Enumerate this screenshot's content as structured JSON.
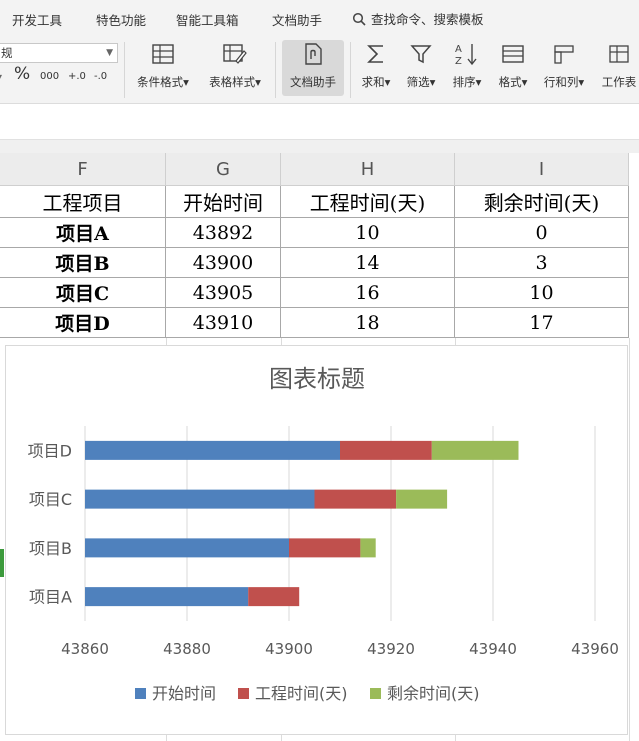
{
  "menu": {
    "tabs": [
      "开发工具",
      "特色功能",
      "智能工具箱",
      "文档助手"
    ],
    "search_placeholder": "查找命令、搜索模板"
  },
  "ribbon": {
    "number_format_value": "规",
    "format_buttons": [
      "%",
      "000",
      "+.0",
      "-.0"
    ],
    "buttons": [
      {
        "label": "条件格式",
        "icon": "conditional-format-icon",
        "dropdown": true
      },
      {
        "label": "表格样式",
        "icon": "table-style-icon",
        "dropdown": true
      },
      {
        "label": "文档助手",
        "icon": "document-assistant-icon",
        "dropdown": false,
        "active": true
      },
      {
        "label": "求和",
        "icon": "sum-icon",
        "dropdown": true
      },
      {
        "label": "筛选",
        "icon": "filter-icon",
        "dropdown": true
      },
      {
        "label": "排序",
        "icon": "sort-icon",
        "dropdown": true
      },
      {
        "label": "格式",
        "icon": "format-icon",
        "dropdown": true
      },
      {
        "label": "行和列",
        "icon": "rows-columns-icon",
        "dropdown": true
      },
      {
        "label": "工作表",
        "icon": "worksheet-icon",
        "dropdown": false
      }
    ]
  },
  "sheet": {
    "columns": [
      "F",
      "G",
      "H",
      "I"
    ],
    "header_row": [
      "工程项目",
      "开始时间",
      "工程时间(天)",
      "剩余时间(天)"
    ],
    "rows": [
      [
        "项目A",
        "43892",
        "10",
        "0"
      ],
      [
        "项目B",
        "43900",
        "14",
        "3"
      ],
      [
        "项目C",
        "43905",
        "16",
        "10"
      ],
      [
        "项目D",
        "43910",
        "18",
        "17"
      ]
    ]
  },
  "colors": {
    "series_start": "#4f81bd",
    "series_duration": "#c0504d",
    "series_remaining": "#9bbb59",
    "active_row_marker": "#3c9a3c"
  },
  "chart_data": {
    "type": "bar",
    "orientation": "horizontal",
    "stacked": true,
    "title": "图表标题",
    "categories": [
      "项目A",
      "项目B",
      "项目C",
      "项目D"
    ],
    "series": [
      {
        "name": "开始时间",
        "values": [
          43892,
          43900,
          43905,
          43910
        ]
      },
      {
        "name": "工程时间(天)",
        "values": [
          10,
          14,
          16,
          18
        ]
      },
      {
        "name": "剩余时间(天)",
        "values": [
          0,
          3,
          10,
          17
        ]
      }
    ],
    "xlim": [
      43860,
      43960
    ],
    "x_ticks": [
      "43860",
      "43880",
      "43900",
      "43920",
      "43940",
      "43960"
    ],
    "grid": true,
    "legend_position": "bottom"
  }
}
